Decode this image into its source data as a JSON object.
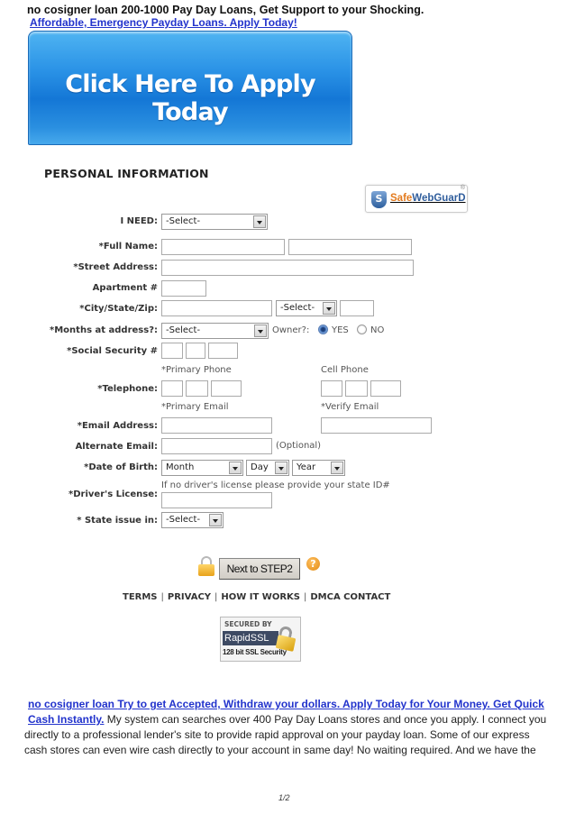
{
  "header": {
    "title": "no cosigner loan 200-1000 Pay Day Loans, Get Support to your Shocking.",
    "link": "Affordable, Emergency Payday Loans. Apply Today!"
  },
  "banner": {
    "label": "Click Here To Apply Today",
    "color": "#1f86de"
  },
  "form": {
    "section_title": "PERSONAL INFORMATION",
    "badge": {
      "safe": "Safe",
      "web": "WebGuarD",
      "reg": "®"
    },
    "i_need": {
      "label": "I NEED:",
      "value": "-Select-"
    },
    "full_name": {
      "label": "*Full Name:"
    },
    "street": {
      "label": "*Street Address:"
    },
    "apartment": {
      "label": "Apartment #"
    },
    "city_state_zip": {
      "label": "*City/State/Zip:",
      "state_value": "-Select-"
    },
    "months": {
      "label": "*Months at address?:",
      "value": "-Select-"
    },
    "owner": {
      "label": "Owner?:",
      "options": [
        {
          "label": "YES",
          "selected": true
        },
        {
          "label": "NO",
          "selected": false
        }
      ]
    },
    "ssn": {
      "label": "*Social Security #"
    },
    "phone": {
      "primary_label": "*Primary Phone",
      "cell_label": "Cell Phone",
      "label": "*Telephone:"
    },
    "email": {
      "primary_label": "*Primary Email",
      "verify_label": "*Verify Email",
      "label": "*Email Address:"
    },
    "alt_email": {
      "label": "Alternate Email:",
      "note": "(Optional)"
    },
    "dob": {
      "label": "*Date of Birth:",
      "month": "Month",
      "day": "Day",
      "year": "Year"
    },
    "license": {
      "label": "*Driver's License:",
      "hint": "If no driver's license please provide your state ID#"
    },
    "state_issue": {
      "label": "* State issue in:",
      "value": "-Select-"
    },
    "next_button": "Next to STEP2",
    "help": "?",
    "footer_links": [
      "TERMS",
      "PRIVACY",
      "HOW IT WORKS",
      "DMCA CONTACT"
    ],
    "ssl": {
      "top": "SECURED BY",
      "brand": "RapidSSL",
      "bottom": "128 bit SSL Security"
    }
  },
  "body": {
    "link_line1": "no cosigner loan Try to get Accepted, Withdraw your dollars. Apply Today for Your Money. Get Quick",
    "link_line2": "Cash Instantly.",
    "text_line2": " My system can searches over 400 Pay Day Loans stores and once you apply. I connect you",
    "text_line3": "directly to a professional lender's site to provide rapid approval on your payday loan. Some of our express",
    "text_line4": "cash stores can even wire cash directly to your account in same day! No waiting required. And we have the"
  },
  "page": {
    "number": "1/2"
  }
}
